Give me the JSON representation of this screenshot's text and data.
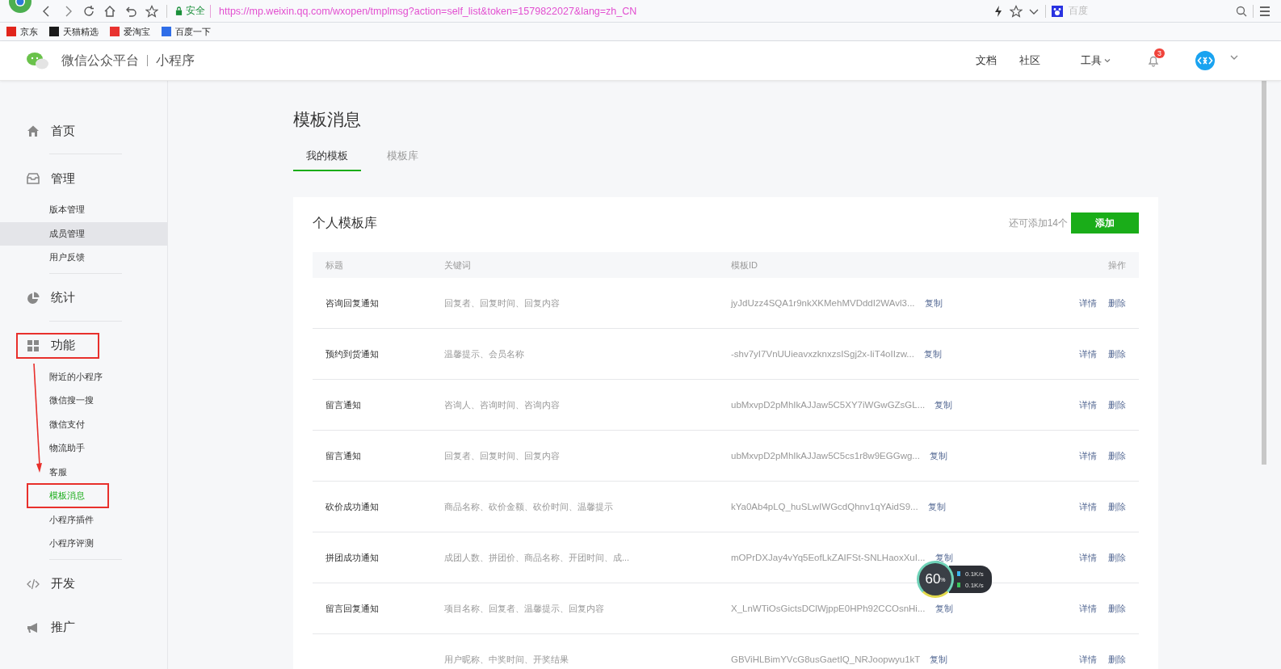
{
  "browser": {
    "secure_label": "安全",
    "url": "https://mp.weixin.qq.com/wxopen/tmplmsg?action=self_list&token=1579822027&lang=zh_CN",
    "search_placeholder": "百度",
    "bookmarks": [
      {
        "label": "京东",
        "color": "#e1251b"
      },
      {
        "label": "天猫精选",
        "color": "#1a1a1a"
      },
      {
        "label": "爱淘宝",
        "color": "#e8322f"
      },
      {
        "label": "百度一下",
        "color": "#2f6ee8"
      }
    ]
  },
  "header": {
    "brand": "微信公众平台",
    "product": "小程序",
    "nav": [
      {
        "label": "文档",
        "kind": "link"
      },
      {
        "label": "社区",
        "kind": "link"
      },
      {
        "label": "工具",
        "kind": "dropdown"
      }
    ],
    "notification_count": "3"
  },
  "sidebar": [
    {
      "label": "首页",
      "annotated": false
    },
    {
      "label": "管理",
      "annotated": false,
      "children": [
        {
          "label": "版本管理",
          "selected": false,
          "highlighted": false,
          "annotated": false
        },
        {
          "label": "成员管理",
          "selected": false,
          "highlighted": true,
          "annotated": false
        },
        {
          "label": "用户反馈",
          "selected": false,
          "highlighted": false,
          "annotated": false
        }
      ]
    },
    {
      "label": "统计",
      "annotated": false
    },
    {
      "label": "功能",
      "annotated": true,
      "children": [
        {
          "label": "附近的小程序",
          "selected": false,
          "highlighted": false,
          "annotated": false
        },
        {
          "label": "微信搜一搜",
          "selected": false,
          "highlighted": false,
          "annotated": false
        },
        {
          "label": "微信支付",
          "selected": false,
          "highlighted": false,
          "annotated": false
        },
        {
          "label": "物流助手",
          "selected": false,
          "highlighted": false,
          "annotated": false
        },
        {
          "label": "客服",
          "selected": false,
          "highlighted": false,
          "annotated": false
        },
        {
          "label": "模板消息",
          "selected": true,
          "highlighted": false,
          "annotated": true
        },
        {
          "label": "小程序插件",
          "selected": false,
          "highlighted": false,
          "annotated": false
        },
        {
          "label": "小程序评测",
          "selected": false,
          "highlighted": false,
          "annotated": false
        }
      ]
    },
    {
      "label": "开发",
      "annotated": false
    },
    {
      "label": "推广",
      "annotated": false
    }
  ],
  "page": {
    "title": "模板消息",
    "tabs": [
      {
        "label": "我的模板",
        "selected": true
      },
      {
        "label": "模板库",
        "selected": false
      }
    ]
  },
  "card": {
    "title": "个人模板库",
    "remaining": "还可添加14个",
    "add_button": "添加",
    "table": {
      "columns": [
        "标题",
        "关键词",
        "模板ID",
        "操作"
      ],
      "rows": [
        {
          "title": "咨询回复通知",
          "keywords": "回复者、回复时间、回复内容",
          "template_id": "jyJdUzz4SQA1r9nkXKMehMVDddI2WAvl3...",
          "copy": "复制",
          "actions": [
            "详情",
            "删除"
          ]
        },
        {
          "title": "预约到货通知",
          "keywords": "温馨提示、会员名称",
          "template_id": "-shv7yI7VnUUieavxzknxzsISgj2x-IiT4oIIzw...",
          "copy": "复制",
          "actions": [
            "详情",
            "删除"
          ]
        },
        {
          "title": "留言通知",
          "keywords": "咨询人、咨询时间、咨询内容",
          "template_id": "ubMxvpD2pMhIkAJJaw5C5XY7iWGwGZsGL...",
          "copy": "复制",
          "actions": [
            "详情",
            "删除"
          ]
        },
        {
          "title": "留言通知",
          "keywords": "回复者、回复时间、回复内容",
          "template_id": "ubMxvpD2pMhIkAJJaw5C5cs1r8w9EGGwg...",
          "copy": "复制",
          "actions": [
            "详情",
            "删除"
          ]
        },
        {
          "title": "砍价成功通知",
          "keywords": "商品名称、砍价金额、砍价时间、温馨提示",
          "template_id": "kYa0Ab4pLQ_huSLwIWGcdQhnv1qYAidS9...",
          "copy": "复制",
          "actions": [
            "详情",
            "删除"
          ]
        },
        {
          "title": "拼团成功通知",
          "keywords": "成团人数、拼团价、商品名称、开团时间、成...",
          "template_id": "mOPrDXJay4vYq5EofLkZAIFSt-SNLHaoxXuI...",
          "copy": "复制",
          "actions": [
            "详情",
            "删除"
          ]
        },
        {
          "title": "留言回复通知",
          "keywords": "项目名称、回复者、温馨提示、回复内容",
          "template_id": "X_LnWTiOsGictsDClWjppE0HPh92CCOsnHi...",
          "copy": "复制",
          "actions": [
            "详情",
            "删除"
          ]
        },
        {
          "keywords": "用户昵称、中奖时间、开奖结果",
          "template_id": "GBViHLBimYVcG8usGaetIQ_NRJoopwyu1kT",
          "copy": "复制",
          "actions": [
            "详情",
            "删除"
          ]
        }
      ]
    }
  },
  "speed_widget": {
    "percent": "60",
    "unit": "%",
    "upload": "0.1K/s",
    "download": "0.1K/s"
  }
}
